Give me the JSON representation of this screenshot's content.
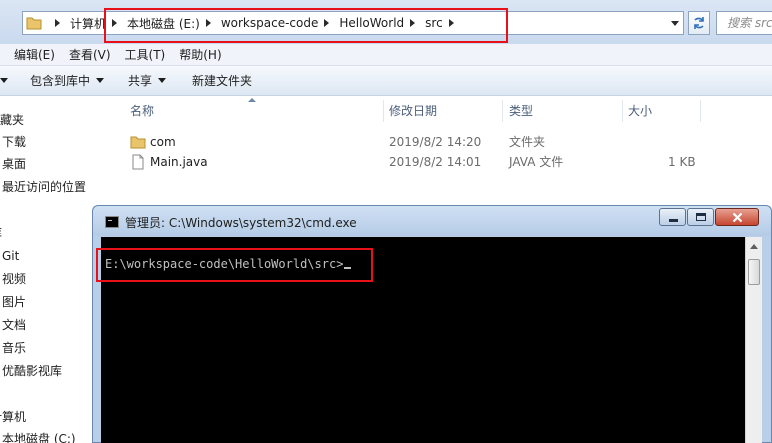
{
  "address_bar": {
    "crumbs": [
      "计算机",
      "本地磁盘 (E:)",
      "workspace-code",
      "HelloWorld",
      "src"
    ],
    "search_placeholder": "搜索 src"
  },
  "menu": [
    "编辑(E)",
    "查看(V)",
    "工具(T)",
    "帮助(H)"
  ],
  "toolbar": {
    "include_in_library": "包含到库中",
    "share": "共享",
    "new_folder": "新建文件夹"
  },
  "nav": {
    "items": [
      "收藏夹",
      "下载",
      "桌面",
      "最近访问的位置",
      "库",
      "Git",
      "视频",
      "图片",
      "文档",
      "音乐",
      "优酷影视库",
      "计算机",
      "本地磁盘 (C:)"
    ]
  },
  "file_list": {
    "columns": [
      "名称",
      "修改日期",
      "类型",
      "大小"
    ],
    "rows": [
      {
        "name": "com",
        "modified": "2019/8/2 14:20",
        "type": "文件夹",
        "size": ""
      },
      {
        "name": "Main.java",
        "modified": "2019/8/2 14:01",
        "type": "JAVA 文件",
        "size": "1 KB"
      }
    ]
  },
  "cmd": {
    "title": "管理员: C:\\Windows\\system32\\cmd.exe",
    "prompt": "E:\\workspace-code\\HelloWorld\\src>"
  },
  "colors": {
    "highlight": "#e8111a",
    "console_bg": "#000000",
    "console_text": "#c0c0c0"
  }
}
